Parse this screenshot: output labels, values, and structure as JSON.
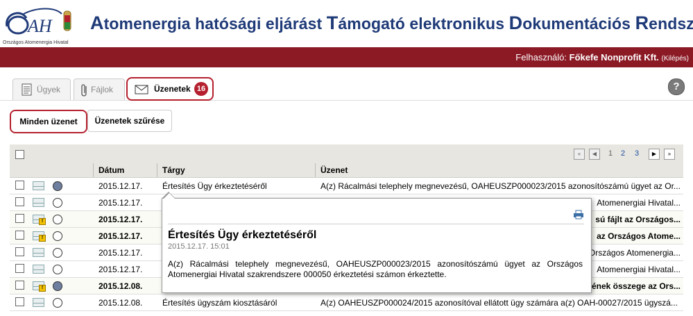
{
  "app": {
    "logo_text": "OAH",
    "logo_subtitle": "Országos Atomenergia Hivatal",
    "title_parts": [
      {
        "cap": "A",
        "rest": "tomenergia hatósági eljárást "
      },
      {
        "cap": "T",
        "rest": "ámogató elektronikus "
      },
      {
        "cap": "D",
        "rest": "okumentációs "
      },
      {
        "cap": "R",
        "rest": "endszer"
      }
    ]
  },
  "userbar": {
    "label": "Felhasználó:",
    "user": "Főkefe Nonprofit Kft.",
    "logout": "(Kilépés)"
  },
  "tabs": [
    {
      "label": "Ügyek",
      "icon": "document-icon",
      "active": false
    },
    {
      "label": "Fájlok",
      "icon": "paperclip-icon",
      "active": false
    },
    {
      "label": "Üzenetek",
      "icon": "envelope-icon",
      "active": true,
      "badge": "16"
    }
  ],
  "help_label": "?",
  "filter_buttons": [
    {
      "label": "Minden üzenet",
      "active": true
    },
    {
      "label": "Üzenetek szűrése",
      "active": false
    }
  ],
  "pager": {
    "pages": [
      "1",
      "2",
      "3"
    ],
    "first_icon": "first-page-icon",
    "prev_icon": "prev-page-icon",
    "next_icon": "next-page-icon",
    "last_icon": "last-page-icon"
  },
  "table": {
    "columns": [
      "Dátum",
      "Tárgy",
      "Üzenet"
    ],
    "rows": [
      {
        "date": "2015.12.17.",
        "subject": "Értesítés Ügy érkeztetéséről",
        "message": "A(z) Rácalmási telephely megnevezésű, OAHEUSZP000023/2015 azonosítószámú ügyet az Or...",
        "unread": false,
        "warn": false,
        "filled": true
      },
      {
        "date": "2015.12.17.",
        "subject": "",
        "message": "Atomenergiai Hivatal...",
        "unread": false,
        "warn": false,
        "filled": false
      },
      {
        "date": "2015.12.17.",
        "subject": "",
        "message": "sú fájlt az Országos...",
        "unread": true,
        "warn": true,
        "filled": false
      },
      {
        "date": "2015.12.17.",
        "subject": "",
        "message": "az Országos Atome...",
        "unread": true,
        "warn": true,
        "filled": false
      },
      {
        "date": "2015.12.17.",
        "subject": "",
        "message": "Országos Atomenergia...",
        "unread": false,
        "warn": false,
        "filled": false
      },
      {
        "date": "2015.12.17.",
        "subject": "",
        "message": "Atomenergiai Hivatal...",
        "unread": false,
        "warn": false,
        "filled": false
      },
      {
        "date": "2015.12.08.",
        "subject": "",
        "message": "ének összege az Ors...",
        "unread": true,
        "warn": true,
        "filled": true
      },
      {
        "date": "2015.12.08.",
        "subject": "Értesítés ügyszám kiosztásáról",
        "message": "A(z) OAHEUSZP000024/2015 azonosítóval ellátott ügy számára a(z) OAH-00027/2015 ügyszá...",
        "unread": false,
        "warn": false,
        "filled": false
      }
    ]
  },
  "popup": {
    "title": "Értesítés Ügy érkeztetéséről",
    "datetime": "2015.12.17. 15:01",
    "body": "A(z) Rácalmási telephely megnevezésű, OAHEUSZP000023/2015 azonosítószámú ügyet az Országos Atomenergiai Hivatal szakrendszere 000050 érkeztetési számon érkeztette.",
    "print_icon": "print-icon"
  },
  "colors": {
    "brand_red": "#8b1a25",
    "highlight_red": "#b5202e",
    "title_blue": "#1f3a78"
  }
}
